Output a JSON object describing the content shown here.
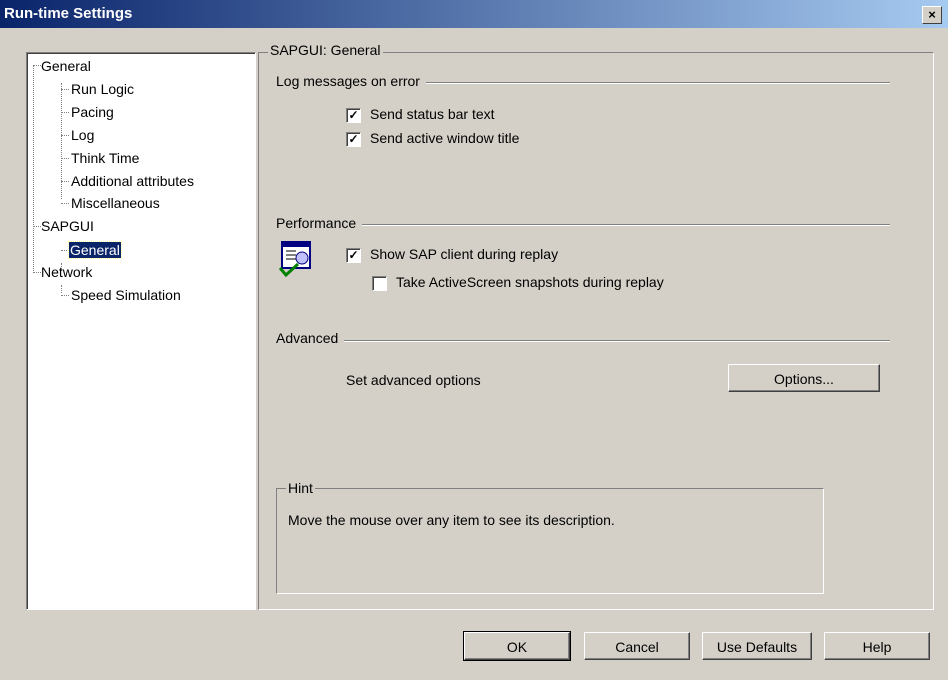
{
  "window": {
    "title": "Run-time Settings",
    "close_glyph": "×"
  },
  "tree": {
    "items": [
      {
        "label": "General"
      },
      {
        "label": "Run Logic"
      },
      {
        "label": "Pacing"
      },
      {
        "label": "Log"
      },
      {
        "label": "Think Time"
      },
      {
        "label": "Additional attributes"
      },
      {
        "label": "Miscellaneous"
      },
      {
        "label": "SAPGUI"
      },
      {
        "label": "General",
        "selected": true
      },
      {
        "label": "Network"
      },
      {
        "label": "Speed Simulation"
      }
    ]
  },
  "panel": {
    "title": "SAPGUI: General",
    "log": {
      "heading": "Log messages on error",
      "options": [
        {
          "label": "Send status bar text",
          "checked": true
        },
        {
          "label": "Send active window title",
          "checked": true
        }
      ]
    },
    "performance": {
      "heading": "Performance",
      "icon": "sap-client-icon",
      "options": [
        {
          "label": "Show SAP client during replay",
          "checked": true
        },
        {
          "label": "Take ActiveScreen snapshots during replay",
          "checked": false
        }
      ]
    },
    "advanced": {
      "heading": "Advanced",
      "text": "Set advanced options",
      "button": "Options..."
    },
    "hint": {
      "heading": "Hint",
      "text": "Move the mouse over any item to see its description."
    }
  },
  "buttons": {
    "ok": "OK",
    "cancel": "Cancel",
    "defaults": "Use Defaults",
    "help": "Help"
  },
  "check_glyph": "✓"
}
